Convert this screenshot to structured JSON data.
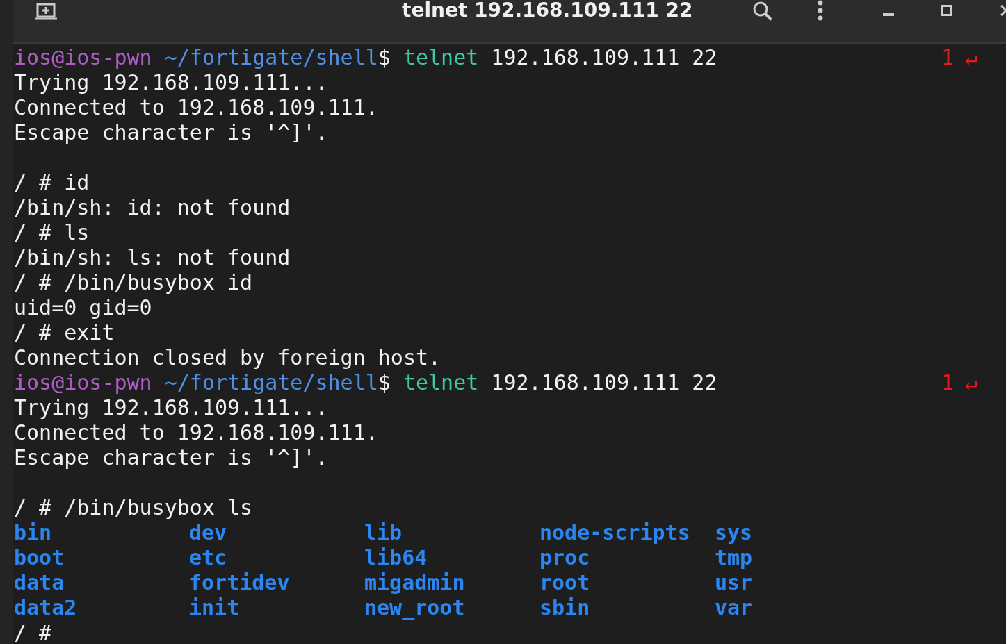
{
  "window": {
    "title": "telnet 192.168.109.111 22"
  },
  "lines": [
    {
      "kind": "prompt",
      "user": "ios@ios-pwn",
      "path": "~/fortigate/shell",
      "symbol": "$",
      "command": "telnet",
      "args": "192.168.109.111 22",
      "status": "1",
      "return_mark": "↵"
    },
    {
      "kind": "output",
      "text": "Trying 192.168.109.111..."
    },
    {
      "kind": "output",
      "text": "Connected to 192.168.109.111."
    },
    {
      "kind": "output",
      "text": "Escape character is '^]'."
    },
    {
      "kind": "blank"
    },
    {
      "kind": "output",
      "text": "/ # id"
    },
    {
      "kind": "output",
      "text": "/bin/sh: id: not found"
    },
    {
      "kind": "output",
      "text": "/ # ls"
    },
    {
      "kind": "output",
      "text": "/bin/sh: ls: not found"
    },
    {
      "kind": "output",
      "text": "/ # /bin/busybox id"
    },
    {
      "kind": "output",
      "text": "uid=0 gid=0"
    },
    {
      "kind": "output",
      "text": "/ # exit"
    },
    {
      "kind": "output",
      "text": "Connection closed by foreign host."
    },
    {
      "kind": "prompt",
      "user": "ios@ios-pwn",
      "path": "~/fortigate/shell",
      "symbol": "$",
      "command": "telnet",
      "args": "192.168.109.111 22",
      "status": "1",
      "return_mark": "↵"
    },
    {
      "kind": "output",
      "text": "Trying 192.168.109.111..."
    },
    {
      "kind": "output",
      "text": "Connected to 192.168.109.111."
    },
    {
      "kind": "output",
      "text": "Escape character is '^]'."
    },
    {
      "kind": "blank"
    },
    {
      "kind": "output",
      "text": "/ # /bin/busybox ls"
    },
    {
      "kind": "listing",
      "entries": [
        "bin",
        "dev",
        "lib",
        "node-scripts",
        "sys"
      ]
    },
    {
      "kind": "listing",
      "entries": [
        "boot",
        "etc",
        "lib64",
        "proc",
        "tmp"
      ]
    },
    {
      "kind": "listing",
      "entries": [
        "data",
        "fortidev",
        "migadmin",
        "root",
        "usr"
      ]
    },
    {
      "kind": "listing",
      "entries": [
        "data2",
        "init",
        "new_root",
        "sbin",
        "var"
      ]
    },
    {
      "kind": "output",
      "text": "/ #"
    }
  ]
}
